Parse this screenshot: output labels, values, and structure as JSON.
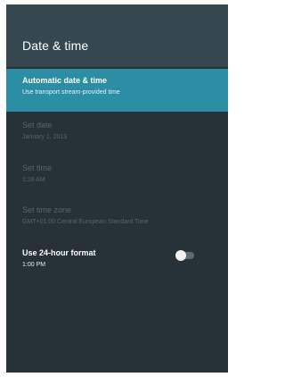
{
  "header": {
    "title": "Date & time"
  },
  "settings": {
    "items": [
      {
        "title": "Automatic date & time",
        "subtitle": "Use transport stream-provided time",
        "state": "selected"
      },
      {
        "title": "Set date",
        "subtitle": "January 1, 2013",
        "state": "disabled"
      },
      {
        "title": "Set time",
        "subtitle": "1:28 AM",
        "state": "disabled"
      },
      {
        "title": "Set time zone",
        "subtitle": "GMT+01:00 Central European Standard Time",
        "state": "disabled"
      },
      {
        "title": "Use 24-hour format",
        "subtitle": "1:00 PM",
        "state": "enabled",
        "toggle_on": false
      }
    ]
  },
  "colors": {
    "background": "#263238",
    "header": "#37474f",
    "accent": "#2b8ea5",
    "disabled_text": "#56636a"
  }
}
